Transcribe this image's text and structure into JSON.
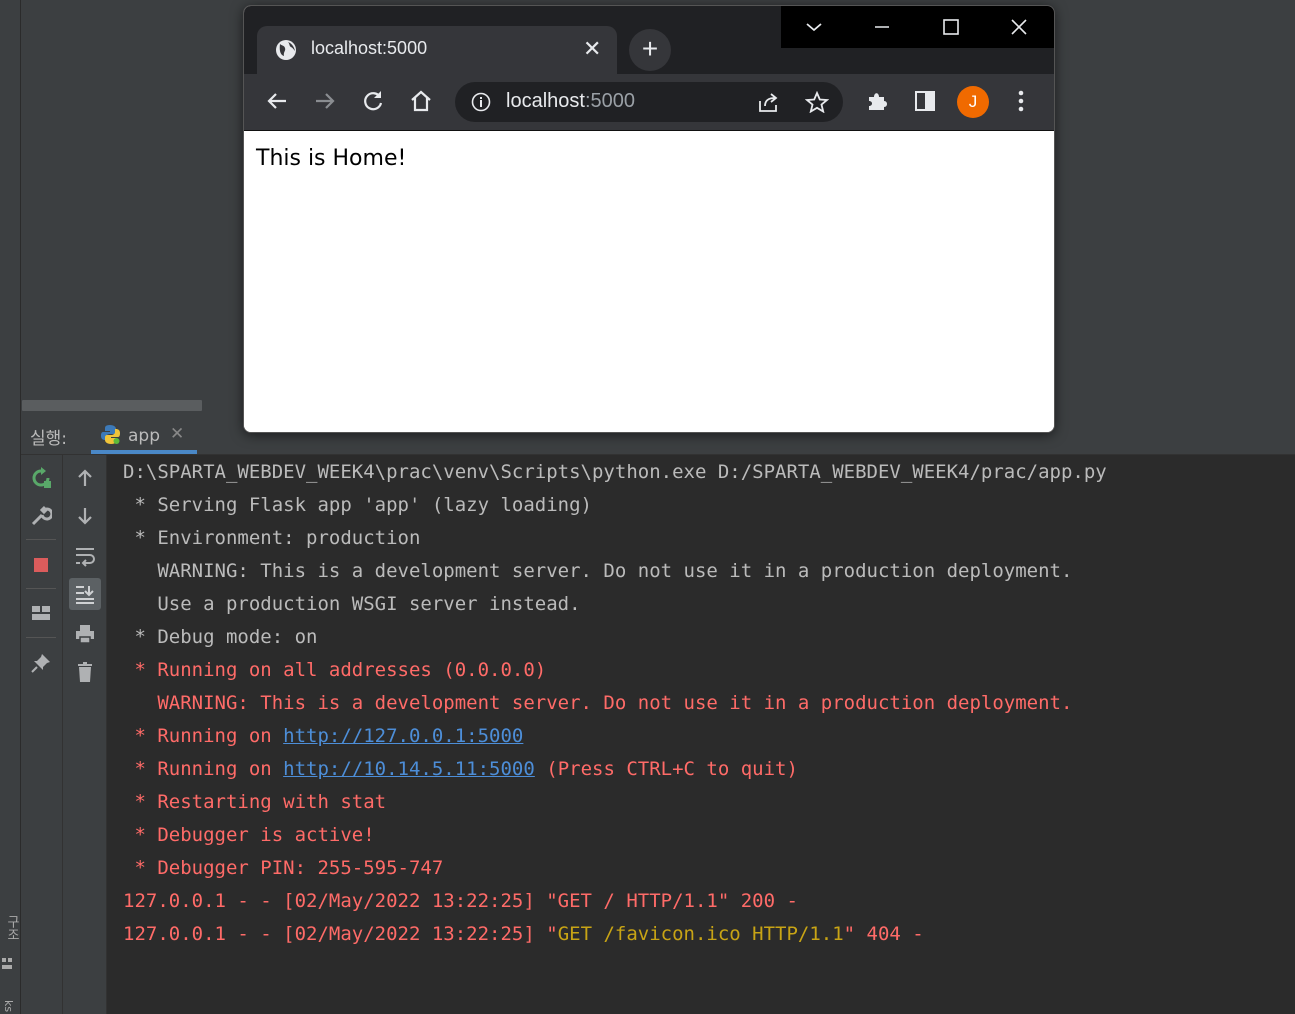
{
  "ide": {
    "run_label": "실행:",
    "run_tab": "app",
    "left_strip_label": "구조",
    "left_strip_bottom": "ks",
    "console_lines": [
      [
        {
          "t": "D:\\SPARTA_WEBDEV_WEEK4\\prac\\venv\\Scripts\\python.exe D:/SPARTA_WEBDEV_WEEK4/prac/app.py",
          "c": "gray"
        }
      ],
      [
        {
          "t": " * Serving Flask app 'app' (lazy loading)",
          "c": "gray"
        }
      ],
      [
        {
          "t": " * Environment: production",
          "c": "gray"
        }
      ],
      [
        {
          "t": "   WARNING: This is a development server. Do not use it in a production deployment.",
          "c": "gray"
        }
      ],
      [
        {
          "t": "   Use a production WSGI server instead.",
          "c": "gray"
        }
      ],
      [
        {
          "t": " * Debug mode: on",
          "c": "gray"
        }
      ],
      [
        {
          "t": " * Running on all addresses (0.0.0.0)",
          "c": "red"
        }
      ],
      [
        {
          "t": "   WARNING: This is a development server. Do not use it in a production deployment.",
          "c": "red"
        }
      ],
      [
        {
          "t": " * Running on ",
          "c": "red"
        },
        {
          "t": "http://127.0.0.1:5000",
          "c": "link"
        }
      ],
      [
        {
          "t": " * Running on ",
          "c": "red"
        },
        {
          "t": "http://10.14.5.11:5000",
          "c": "link"
        },
        {
          "t": " (Press CTRL+C to quit)",
          "c": "red"
        }
      ],
      [
        {
          "t": " * Restarting with stat",
          "c": "red"
        }
      ],
      [
        {
          "t": " * Debugger is active!",
          "c": "red"
        }
      ],
      [
        {
          "t": " * Debugger PIN: 255-595-747",
          "c": "red"
        }
      ],
      [
        {
          "t": "127.0.0.1 - - [02/May/2022 13:22:25] \"GET / HTTP/1.1\" 200 -",
          "c": "red"
        }
      ],
      [
        {
          "t": "127.0.0.1 - - [02/May/2022 13:22:25] \"",
          "c": "red"
        },
        {
          "t": "GET /favicon.ico HTTP/1.1",
          "c": "yellow"
        },
        {
          "t": "\" 404 -",
          "c": "red"
        }
      ]
    ]
  },
  "browser": {
    "tab_title": "localhost:5000",
    "url_host": "localhost",
    "url_port": ":5000",
    "avatar_letter": "J",
    "page_text": "This is Home!"
  },
  "colors": {
    "console_bg": "#2b2b2b",
    "console_text": "#bbbbbb",
    "console_red": "#ff6b68",
    "console_link": "#4d8ed8",
    "console_yellow": "#c8a415",
    "avatar": "#f06a00"
  }
}
